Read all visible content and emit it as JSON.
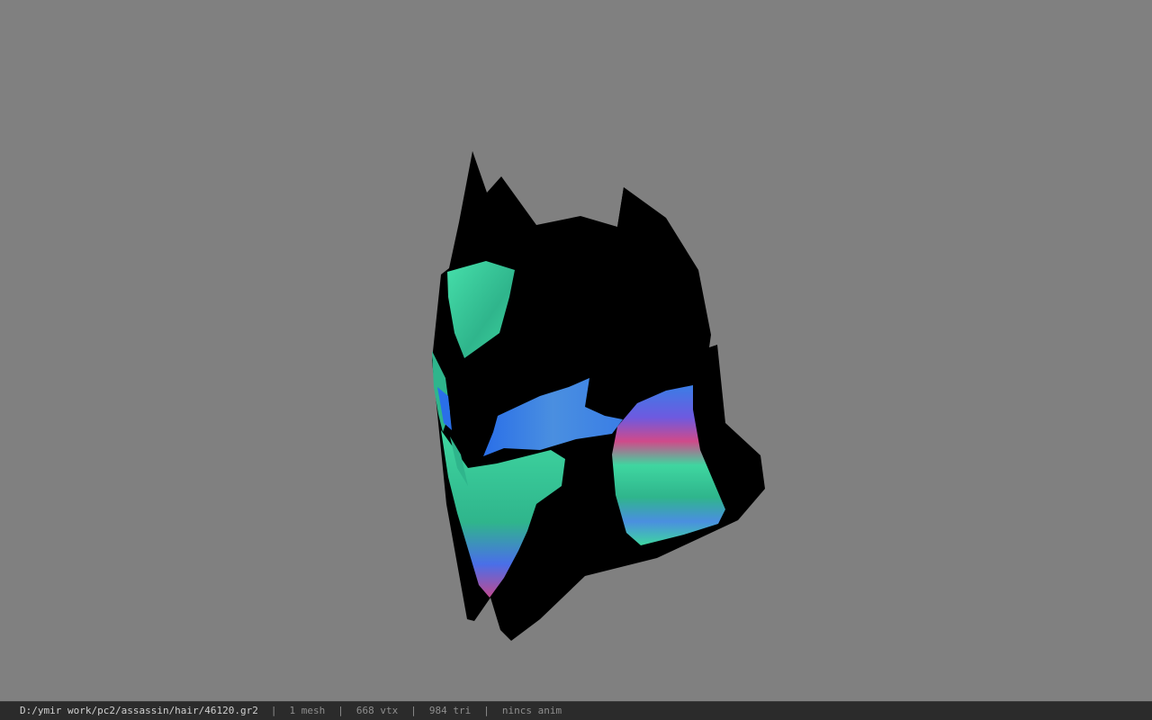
{
  "viewer": {
    "background_color": "#808080",
    "model": {
      "type": "helmet-mesh",
      "base_color": "#000000",
      "texture_colors": [
        "#3fd6a0",
        "#4a8fe0",
        "#d04a8a",
        "#2a6fe8"
      ]
    }
  },
  "status": {
    "file_path": "D:/ymir work/pc2/assassin/hair/46120.gr2",
    "sep": "|",
    "mesh_count": "1 mesh",
    "vertex_count": "668 vtx",
    "triangle_count": "984 tri",
    "anim": "nincs anim"
  }
}
